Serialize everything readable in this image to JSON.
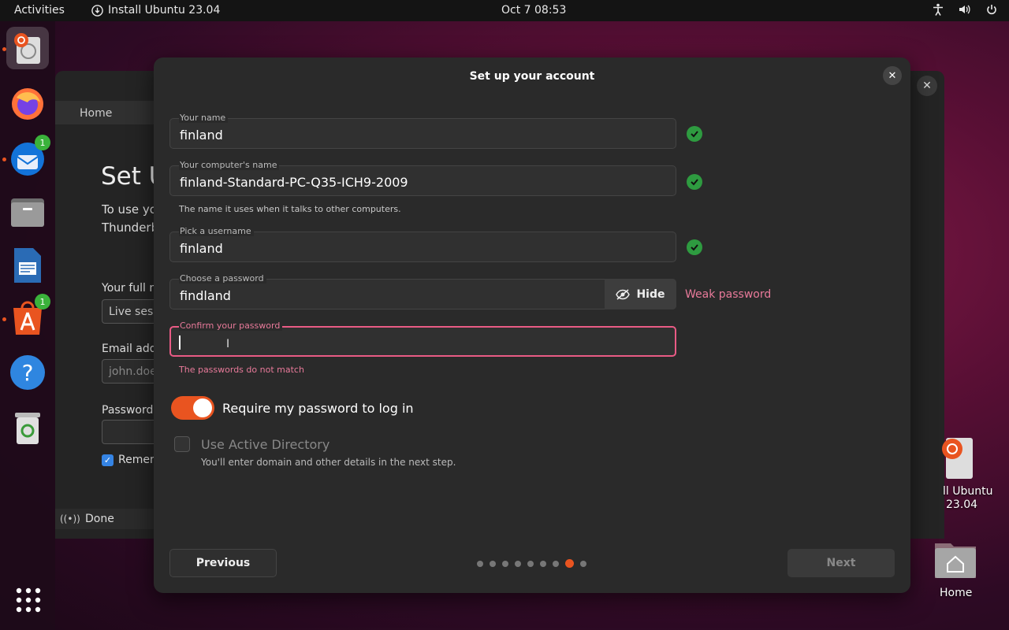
{
  "topbar": {
    "activities": "Activities",
    "app_name": "Install Ubuntu 23.04",
    "clock": "Oct 7  08:53"
  },
  "dock": {
    "items": [
      {
        "name": "ubuntu-installer",
        "badge": ""
      },
      {
        "name": "firefox",
        "badge": ""
      },
      {
        "name": "thunderbird",
        "badge": "1"
      },
      {
        "name": "files",
        "badge": ""
      },
      {
        "name": "libreoffice-writer",
        "badge": ""
      },
      {
        "name": "app-center",
        "badge": "1"
      },
      {
        "name": "help",
        "badge": ""
      },
      {
        "name": "trash",
        "badge": ""
      }
    ]
  },
  "background_window": {
    "home": "Home",
    "title": "Set U",
    "text_line1": "To use yo",
    "text_line2": "Thunderb",
    "full_name_label": "Your full n",
    "full_name_value": "Live sess",
    "email_label": "Email addr",
    "email_placeholder": "john.doe",
    "password_label": "Password",
    "remember_label": "Remen",
    "done": "Done"
  },
  "desktop": {
    "installer_label_line1": "ll Ubuntu",
    "installer_label_line2": "23.04",
    "home_label": "Home"
  },
  "dialog": {
    "title": "Set up your account",
    "your_name": {
      "label": "Your name",
      "value": "finland"
    },
    "computer_name": {
      "label": "Your computer's name",
      "value": "finland-Standard-PC-Q35-ICH9-2009",
      "hint": "The name it uses when it talks to other computers."
    },
    "username": {
      "label": "Pick a username",
      "value": "finland"
    },
    "password": {
      "label": "Choose a password",
      "value": "findland",
      "hide_label": "Hide",
      "strength": "Weak password"
    },
    "confirm": {
      "label": "Confirm your password",
      "value": "",
      "error": "The passwords do not match"
    },
    "require_password": {
      "label": "Require my password to log in",
      "on": true
    },
    "active_directory": {
      "label": "Use Active Directory",
      "hint": "You'll enter domain and other details in the next step.",
      "checked": false
    },
    "previous_label": "Previous",
    "next_label": "Next",
    "steps_total": 9,
    "steps_current": 8
  },
  "colors": {
    "accent": "#e95420",
    "error": "#e87a9a",
    "success": "#2e9b40"
  }
}
